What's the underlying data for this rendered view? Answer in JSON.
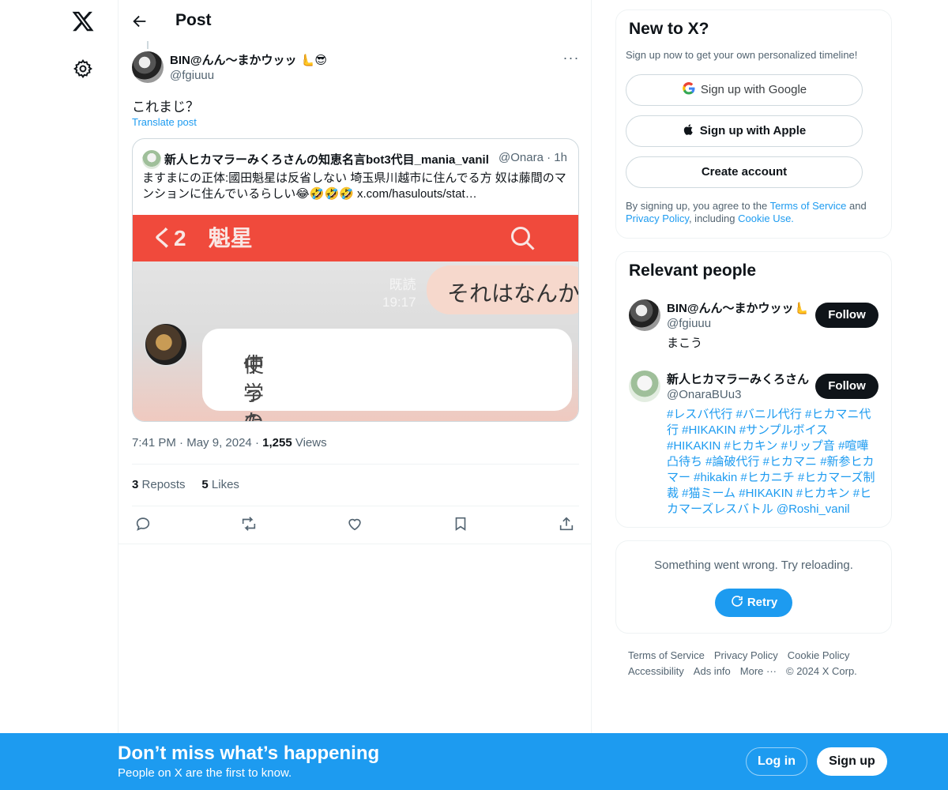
{
  "nav": {
    "logo_icon": "x-logo-icon",
    "settings_icon": "gear-icon"
  },
  "header": {
    "title": "Post",
    "back_icon": "arrow-left-icon"
  },
  "post": {
    "author_name": "BIN@んん〜まかウッッ",
    "author_emoji": "🫷😎",
    "author_handle": "@fgiuuu",
    "text": "これまじ？",
    "translate_label": "Translate post",
    "time": "7:41 PM",
    "date": "May 9, 2024",
    "views_count": "1,255",
    "views_label": "Views",
    "reposts_count": "3",
    "reposts_label": "Reposts",
    "likes_count": "5",
    "likes_label": "Likes"
  },
  "quote": {
    "name": "新人ヒカマラーみくろさんの知恵名言bot3代目_mania_vanil",
    "handle": "@Onara",
    "time": "1h",
    "text_line1": "ますまにの正体:國田魁星は反省しない 埼玉県川越市に住んでる方 奴は藤間のマ",
    "text_line2": "ンションに住んでいるらしい😂🤣🤣🤣  x.com/hasulouts/stat…",
    "image": {
      "header_text": "く2　魁星",
      "bubble1": "それはなんか",
      "read_label": "既読",
      "read_time": "19:17",
      "bubble2_line1": "中学のときから出会い厨のクレカ",
      "bubble2_line2": "使ったりしてたけどセーフや"
    }
  },
  "signup_card": {
    "title": "New to X?",
    "subtitle": "Sign up now to get your own personalized timeline!",
    "google": "Sign up with Google",
    "apple": "Sign up with Apple",
    "create": "Create account",
    "terms_pre": "By signing up, you agree to the ",
    "terms_link": "Terms of Service",
    "terms_and": " and ",
    "privacy_link": "Privacy Policy",
    "including": ", including ",
    "cookie_link": "Cookie Use."
  },
  "relevant": {
    "title": "Relevant people",
    "people": [
      {
        "name": "BIN@んん〜まかウッッ🫷",
        "handle": "@fgiuuu",
        "bio": "まこう",
        "follow": "Follow"
      },
      {
        "name": "新人ヒカマラーみくろさん",
        "handle": "@OnaraBUu3",
        "bio": "#レスバ代行 #バニル代行 #ヒカマニ代行 #HIKAKIN #サンプルボイス #HIKAKIN #ヒカキン #リップ音 #喧嘩凸待ち #論破代行 #ヒカマニ #新参ヒカマー #hikakin #ヒカニチ #ヒカマーズ制裁 #猫ミーム #HIKAKIN #ヒカキン #ヒカマーズレスバトル @Roshi_vanil",
        "follow": "Follow"
      }
    ]
  },
  "error_card": {
    "message": "Something went wrong. Try reloading.",
    "retry": "Retry"
  },
  "footer": {
    "terms": "Terms of Service",
    "privacy": "Privacy Policy",
    "cookie": "Cookie Policy",
    "accessibility": "Accessibility",
    "ads": "Ads info",
    "more": "More ···",
    "copyright": "© 2024 X Corp."
  },
  "banner": {
    "title": "Don’t miss what’s happening",
    "subtitle": "People on X are the first to know.",
    "login": "Log in",
    "signup": "Sign up"
  },
  "colors": {
    "accent": "#1d9bf0",
    "text": "#0f1419",
    "muted": "#536471"
  }
}
